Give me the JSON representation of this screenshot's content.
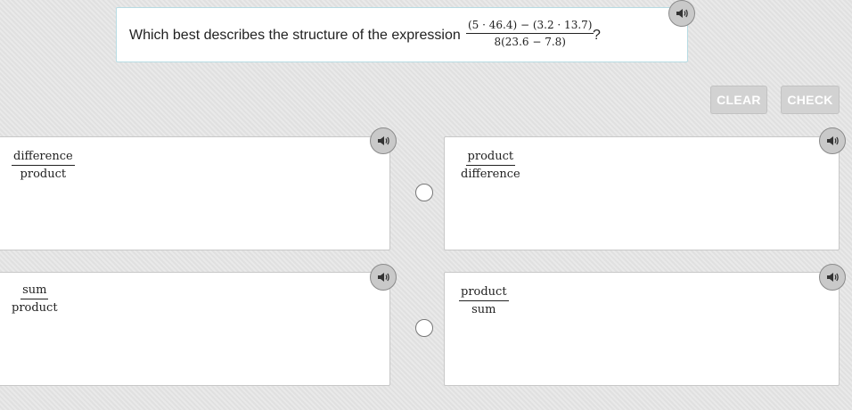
{
  "question": {
    "prompt": "Which best describes the structure of the expression",
    "expression_numerator": "(5 · 46.4) − (3.2 · 13.7)",
    "expression_denominator": "8(23.6 − 7.8)",
    "trailing": "?"
  },
  "buttons": {
    "clear_label": "CLEAR",
    "check_label": "CHECK"
  },
  "choices": [
    {
      "numerator": "difference",
      "denominator": "product"
    },
    {
      "numerator": "product",
      "denominator": "difference"
    },
    {
      "numerator": "sum",
      "denominator": "product"
    },
    {
      "numerator": "product",
      "denominator": "sum"
    }
  ]
}
